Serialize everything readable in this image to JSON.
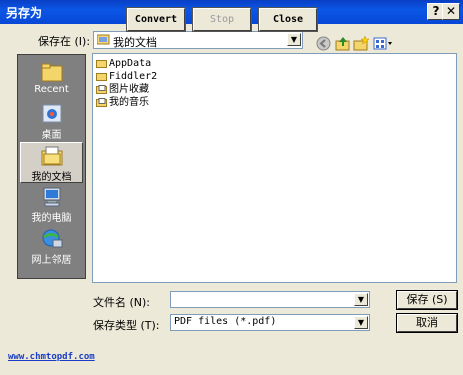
{
  "window": {
    "title": "另存为",
    "help_label": "?",
    "close_label": "✕"
  },
  "toolbar": {
    "save_in_label": "保存在 (I):",
    "save_in_value": "我的文档",
    "back_icon": "back-icon",
    "up_icon": "up-folder-icon",
    "new_folder_icon": "new-folder-icon",
    "views_icon": "views-menu-icon"
  },
  "places": [
    {
      "label": "Recent",
      "icon": "recent-folder-icon"
    },
    {
      "label": "桌面",
      "icon": "desktop-icon"
    },
    {
      "label": "我的文档",
      "icon": "my-documents-icon"
    },
    {
      "label": "我的电脑",
      "icon": "my-computer-icon"
    },
    {
      "label": "网上邻居",
      "icon": "network-icon"
    }
  ],
  "files": [
    {
      "name": "AppData",
      "icon": "folder-icon"
    },
    {
      "name": "Fiddler2",
      "icon": "folder-icon"
    },
    {
      "name": "图片收藏",
      "icon": "pictures-folder-icon"
    },
    {
      "name": "我的音乐",
      "icon": "music-folder-icon"
    }
  ],
  "fields": {
    "filename_label": "文件名 (N):",
    "filename_value": "",
    "filetype_label": "保存类型 (T):",
    "filetype_value": "PDF files (*.pdf)"
  },
  "buttons": {
    "save": "保存 (S)",
    "cancel": "取消"
  },
  "footer": {
    "link": "www.chmtopdf.com",
    "convert": "Convert",
    "stop": "Stop",
    "close": "Close"
  },
  "colors": {
    "titlebar": "#0a56e6",
    "places_bg": "#808080",
    "link": "#1a3cc6"
  }
}
